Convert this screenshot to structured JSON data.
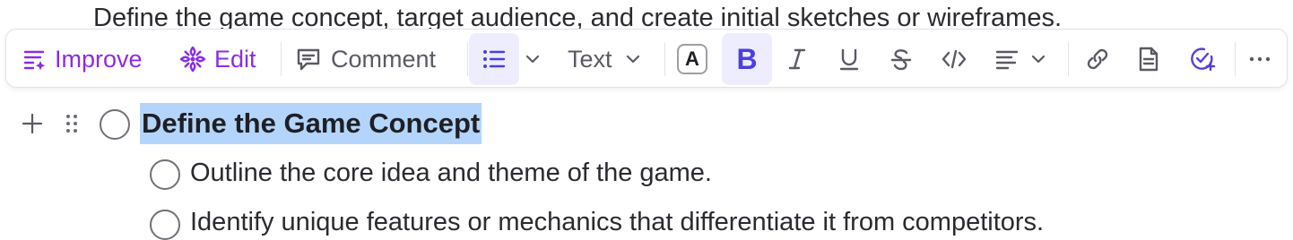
{
  "document": {
    "line_top": "Define the game concept, target audience, and create initial sketches or wireframes.",
    "heading": "Define the Game Concept",
    "subitems": [
      "Outline the core idea and theme of the game.",
      "Identify unique features or mechanics that differentiate it from competitors."
    ]
  },
  "toolbar": {
    "improve_label": "Improve",
    "edit_label": "Edit",
    "comment_label": "Comment",
    "text_style_label": "Text",
    "text_color_glyph": "A",
    "bold_glyph": "B",
    "accent_color": "#8a2ce6",
    "bold_active_color": "#4b3fe0",
    "active_bg_color": "#eeedfd"
  },
  "selection": {
    "highlight_color": "#b3d5fb"
  },
  "icons": {
    "improve": "ai-lines-icon",
    "edit": "ai-flower-icon",
    "comment": "comment-icon",
    "list": "bulleted-list-icon",
    "italic": "italic-icon",
    "underline": "underline-icon",
    "strike": "strikethrough-icon",
    "code": "code-icon",
    "align": "align-left-icon",
    "link": "link-icon",
    "page": "document-icon",
    "task": "task-check-icon",
    "more": "more-icon"
  }
}
